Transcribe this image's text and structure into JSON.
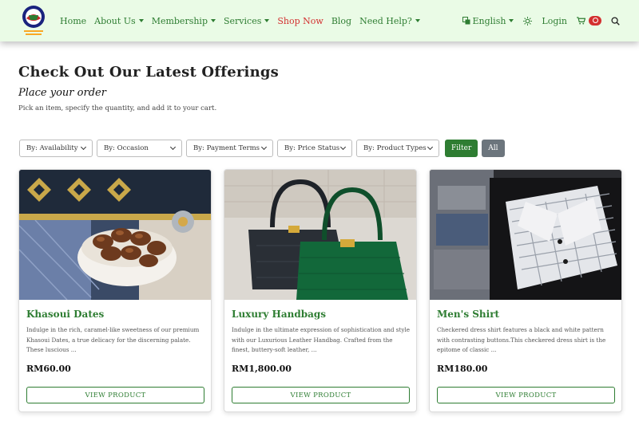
{
  "nav": {
    "logo_icon": "organization-logo",
    "links": [
      {
        "label": "Home",
        "dropdown": false,
        "active": false
      },
      {
        "label": "About Us",
        "dropdown": true,
        "active": false
      },
      {
        "label": "Membership",
        "dropdown": true,
        "active": false
      },
      {
        "label": "Services",
        "dropdown": true,
        "active": false
      },
      {
        "label": "Shop Now",
        "dropdown": false,
        "active": true
      },
      {
        "label": "Blog",
        "dropdown": false,
        "active": false
      },
      {
        "label": "Need Help?",
        "dropdown": true,
        "active": false
      }
    ],
    "language": "English",
    "login": "Login"
  },
  "page": {
    "title": "Check Out Our Latest Offerings",
    "subtitle": "Place your order",
    "description": "Pick an item, specify the quantity, and add it to your cart."
  },
  "filters": {
    "selects": [
      {
        "label": "By: Availability"
      },
      {
        "label": "By: Occasion"
      },
      {
        "label": "By: Payment Terms"
      },
      {
        "label": "By: Price Status"
      },
      {
        "label": "By: Product Types"
      }
    ],
    "filter_button": "Filter",
    "all_button": "All"
  },
  "products": [
    {
      "name": "Khasoui Dates",
      "description": "Indulge in the rich, caramel-like sweetness of our premium Khasoui Dates, a true delicacy for the discerning palate. These luscious ...",
      "price": "RM60.00",
      "button": "VIEW PRODUCT",
      "image_icon": "dates-bowl-photo"
    },
    {
      "name": "Luxury Handbags",
      "description": "Indulge in the ultimate expression of sophistication and style with our Luxurious Leather Handbag. Crafted from the finest, buttery-soft leather, ...",
      "price": "RM1,800.00",
      "button": "VIEW PRODUCT",
      "image_icon": "handbags-photo"
    },
    {
      "name": "Men's Shirt",
      "description": "Checkered dress shirt features a black and white pattern with contrasting buttons.This checkered dress shirt is the epitome of classic ...",
      "price": "RM180.00",
      "button": "VIEW PRODUCT",
      "image_icon": "shirt-photo"
    }
  ],
  "colors": {
    "brand_green": "#2e7d32",
    "active_red": "#d32f2f",
    "nav_bg": "#eafbe6"
  }
}
